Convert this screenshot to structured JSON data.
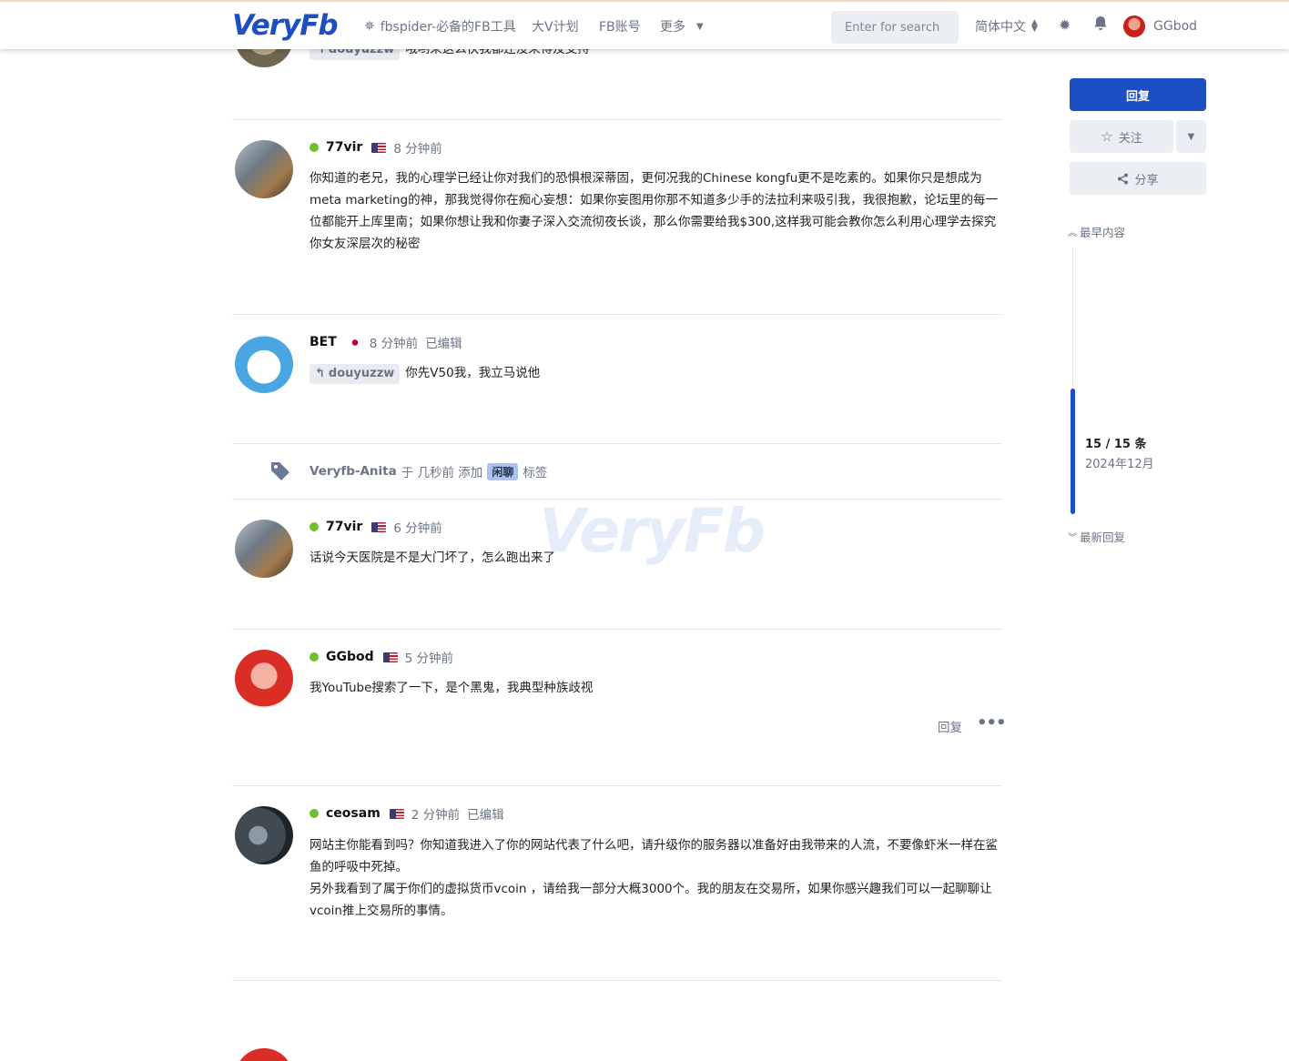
{
  "header": {
    "logo": "VeryFb",
    "nav": [
      {
        "label": "fbspider-必备的FB工具",
        "icon": "spider-icon"
      },
      {
        "label": "大V计划"
      },
      {
        "label": "FB账号"
      },
      {
        "label": "更多"
      }
    ],
    "search_placeholder": "Enter for search",
    "language": "简体中文",
    "username": "GGbod"
  },
  "top_post": {
    "reply_to": "douyuzzw",
    "text": "哦哟来这么快我都还没来得及支持"
  },
  "posts": [
    {
      "user": "77vir",
      "time": "8 分钟前",
      "text": "你知道的老兄，我的心理学已经让你对我们的恐惧根深蒂固，更何况我的Chinese kongfu更不是吃素的。如果你只是想成为meta marketing的神，那我觉得你在痴心妄想：如果你妄图用你那不知道多少手的法拉利来吸引我，我很抱歉，论坛里的每一位都能开上库里南；如果你想让我和你妻子深入交流彻夜长谈，那么你需要给我$300,这样我可能会教你怎么利用心理学去探究你女友深层次的秘密"
    },
    {
      "user": "BET",
      "time": "8 分钟前",
      "edited": "已编辑",
      "reply_to": "douyuzzw",
      "text": "你先V50我，我立马说他"
    },
    {
      "user": "77vir",
      "time": "6 分钟前",
      "text": "话说今天医院是不是大门坏了，怎么跑出来了"
    },
    {
      "user": "GGbod",
      "time": "5 分钟前",
      "text": "我YouTube搜索了一下，是个黑鬼，我典型种族歧视",
      "reply_label": "回复"
    },
    {
      "user": "ceosam",
      "time": "2 分钟前",
      "edited": "已编辑",
      "text": "网站主你能看到吗？你知道我进入了你的网站代表了什么吧，请升级你的服务器以准备好由我带来的人流，不要像虾米一样在鲨鱼的呼吸中死掉。",
      "text2": "另外我看到了属于你们的虚拟货币vcoin ，请给我一部分大概3000个。我的朋友在交易所，如果你感兴趣我们可以一起聊聊让vcoin推上交易所的事情。"
    }
  ],
  "event": {
    "user": "Veryfb-Anita",
    "pre": "于 几秒前 添加",
    "tag": "闲聊",
    "post": "标签"
  },
  "watermark": "VeryFb",
  "sidebar": {
    "reply_button": "回复",
    "follow_button": "关注",
    "share_button": "分享",
    "earliest": "最早内容",
    "latest": "最新回复",
    "position": "15 / 15 条",
    "date": "2024年12月"
  }
}
